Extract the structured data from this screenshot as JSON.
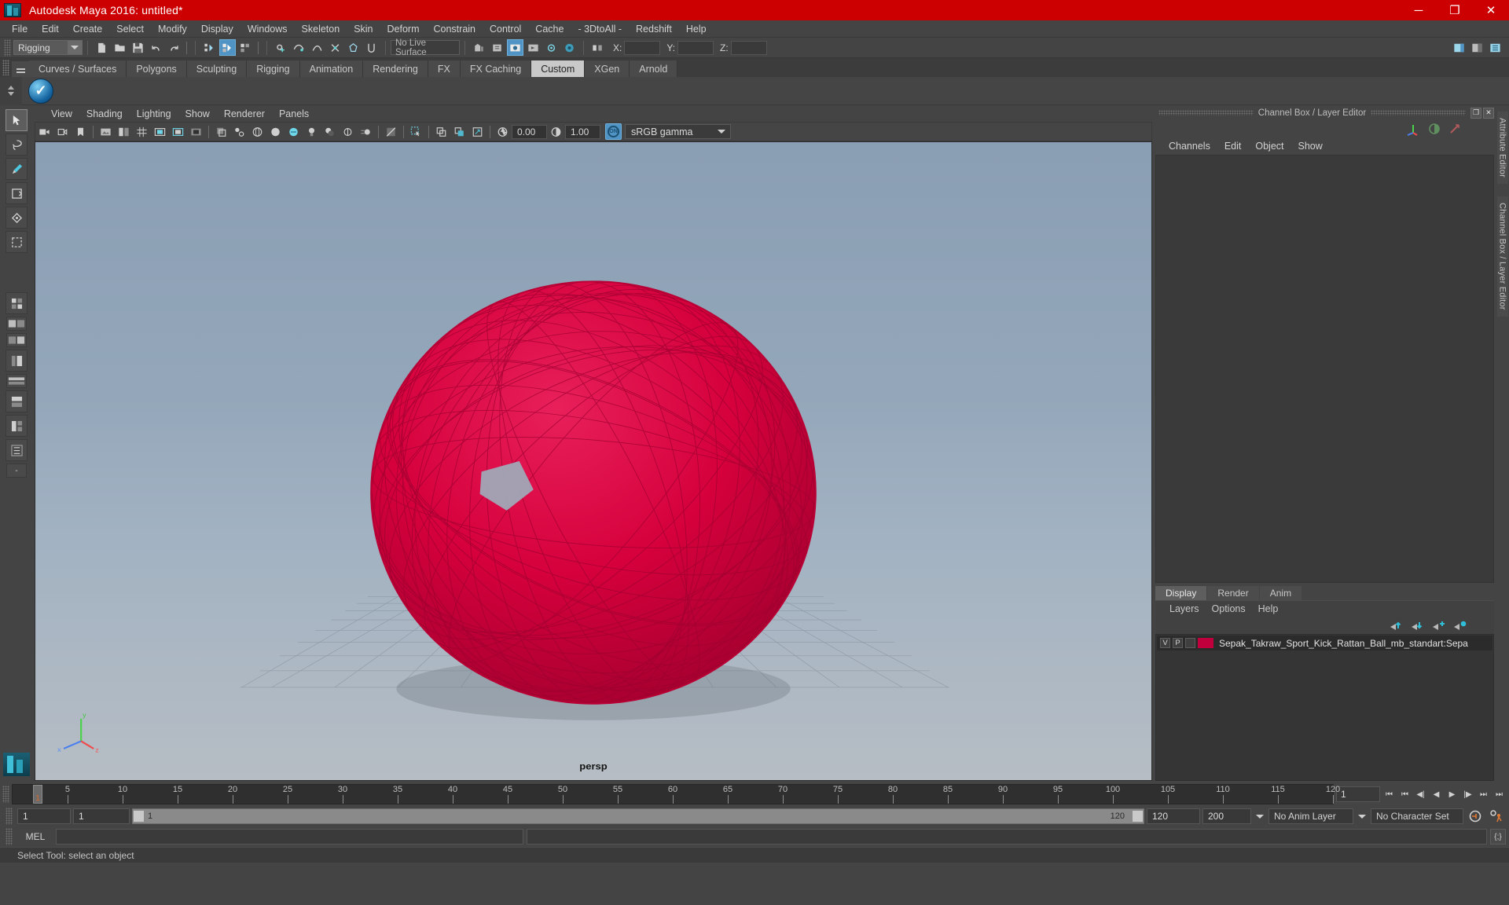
{
  "titlebar": {
    "title": "Autodesk Maya 2016: untitled*",
    "logo_icon": "maya-logo-icon",
    "minimize": "─",
    "maximize": "❐",
    "close": "✕"
  },
  "menubar": {
    "items": [
      "File",
      "Edit",
      "Create",
      "Select",
      "Modify",
      "Display",
      "Windows",
      "Skeleton",
      "Skin",
      "Deform",
      "Constrain",
      "Control",
      "Cache",
      "- 3DtoAll -",
      "Redshift",
      "Help"
    ]
  },
  "statusbar": {
    "mode": "Rigging",
    "live_surface": "No Live Surface",
    "axis": {
      "x_label": "X:",
      "y_label": "Y:",
      "z_label": "Z:",
      "x_value": "",
      "y_value": "",
      "z_value": ""
    },
    "icons": [
      "new-scene-icon",
      "open-scene-icon",
      "save-scene-icon",
      "undo-icon",
      "redo-icon",
      "select-hierarchy-icon",
      "select-object-icon",
      "select-component-icon",
      "snap-grid-icon",
      "snap-curve-icon",
      "snap-point-icon",
      "snap-projected-icon",
      "snap-view-icon",
      "construction-history-icon",
      "render-icon",
      "render-sequence-icon",
      "ipr-icon",
      "render-settings-icon"
    ],
    "right_icons": [
      "show-hide-sidebar-icon",
      "show-attribute-editor-icon",
      "show-channel-box-icon"
    ]
  },
  "shelf": {
    "tabs": [
      "Curves / Surfaces",
      "Polygons",
      "Sculpting",
      "Rigging",
      "Animation",
      "Rendering",
      "FX",
      "FX Caching",
      "Custom",
      "XGen",
      "Arnold"
    ],
    "active_tab": "Custom",
    "item_icon": "blue-check-shelf-icon"
  },
  "toolbox": {
    "items": [
      "select-tool",
      "lasso-select-tool",
      "paint-select-tool",
      "move-tool",
      "rotate-tool",
      "scale-tool",
      "universal-manipulator",
      "last-tool",
      "four-view-layout",
      "persp-outliner-layout",
      "persp-graph-layout",
      "single-persp-layout",
      "two-pane-layout",
      "persp-hypershade-layout",
      "outliner-persp-layout",
      "more-layouts"
    ],
    "minus_label": "-"
  },
  "viewport": {
    "menu": [
      "View",
      "Shading",
      "Lighting",
      "Show",
      "Renderer",
      "Panels"
    ],
    "camera_label": "persp",
    "toolbar": {
      "exposure_value": "0.00",
      "gamma_value": "1.00",
      "color_management": "sRGB gamma",
      "on_badge": "ON",
      "icons": [
        "select-camera-icon",
        "camera-attributes-icon",
        "bookmark-icon",
        "image-plane-icon",
        "two-pane-icon",
        "grid-toggle-icon",
        "film-gate-icon",
        "resolution-gate-icon",
        "gate-mask-icon",
        "xray-icon",
        "xray-joints-icon",
        "wireframe-icon",
        "smooth-shade-icon",
        "flat-shade-icon",
        "shaded-textured-icon",
        "use-all-lights-icon",
        "shadows-icon",
        "ao-icon",
        "motion-blur-icon",
        "multisample-icon",
        "depth-of-field-icon",
        "isolate-select-icon",
        "grid-icon",
        "image-plane-toggle-icon",
        "exposure-icon",
        "gamma-icon"
      ]
    },
    "object": {
      "name": "Sepak Takraw Sport Kick Rattan Ball wireframe sphere",
      "wire_color": "#d5003c"
    },
    "gizmo": {
      "x": "x",
      "y": "y",
      "z": "z"
    }
  },
  "rightdock": {
    "panel_title": "Channel Box / Layer Editor",
    "restore_icon": "restore-panel-icon",
    "close_icon": "close-panel-icon",
    "channel_menu": [
      "Channels",
      "Edit",
      "Object",
      "Show"
    ],
    "cb_icons": [
      "show-manipulators-icon",
      "channel-box-toggle-icon",
      "attribute-editor-icon"
    ],
    "layers": {
      "tabs": [
        "Display",
        "Render",
        "Anim"
      ],
      "active_tab": "Display",
      "menu": [
        "Layers",
        "Options",
        "Help"
      ],
      "buttons": [
        "move-layer-up-icon",
        "move-layer-down-icon",
        "new-layer-icon",
        "new-layer-from-selected-icon"
      ],
      "rows": [
        {
          "visibility": "V",
          "playback": "P",
          "shading": "",
          "color": "#c0003c",
          "name": "Sepak_Takraw_Sport_Kick_Rattan_Ball_mb_standart:Sepa"
        }
      ]
    },
    "vertical_tabs": [
      "Attribute Editor",
      "Channel Box / Layer Editor"
    ]
  },
  "timeslider": {
    "ticks": [
      5,
      10,
      15,
      20,
      25,
      30,
      35,
      40,
      45,
      50,
      55,
      60,
      65,
      70,
      75,
      80,
      85,
      90,
      95,
      100,
      105,
      110,
      115,
      120
    ],
    "start": 1,
    "end": 120,
    "current_frame": "1",
    "playhead_label": "1",
    "current_frame_field": "1",
    "playback_buttons": [
      "go-to-start-icon",
      "step-back-key-icon",
      "step-back-frame-icon",
      "play-backwards-icon",
      "play-forwards-icon",
      "step-forward-frame-icon",
      "step-forward-key-icon",
      "go-to-end-icon"
    ]
  },
  "rangebar": {
    "anim_start": "1",
    "range_start": "1",
    "range_slider_left_label": "1",
    "range_slider_right_label": "120",
    "range_end": "120",
    "anim_end": "200",
    "anim_layer": "No Anim Layer",
    "character_set": "No Character Set",
    "auto_key_icon": "auto-keyframe-icon",
    "anim_prefs_icon": "animation-preferences-icon"
  },
  "commandline": {
    "label": "MEL",
    "input_value": "",
    "output_value": "",
    "script_editor_icon": "script-editor-icon"
  },
  "helpline": {
    "text": "Select Tool: select an object"
  },
  "colors": {
    "title_red": "#cc0000",
    "accent_blue": "#4f94c4",
    "panel_grey": "#444444",
    "wire_red": "#d5003c",
    "orange": "#e07a34"
  }
}
